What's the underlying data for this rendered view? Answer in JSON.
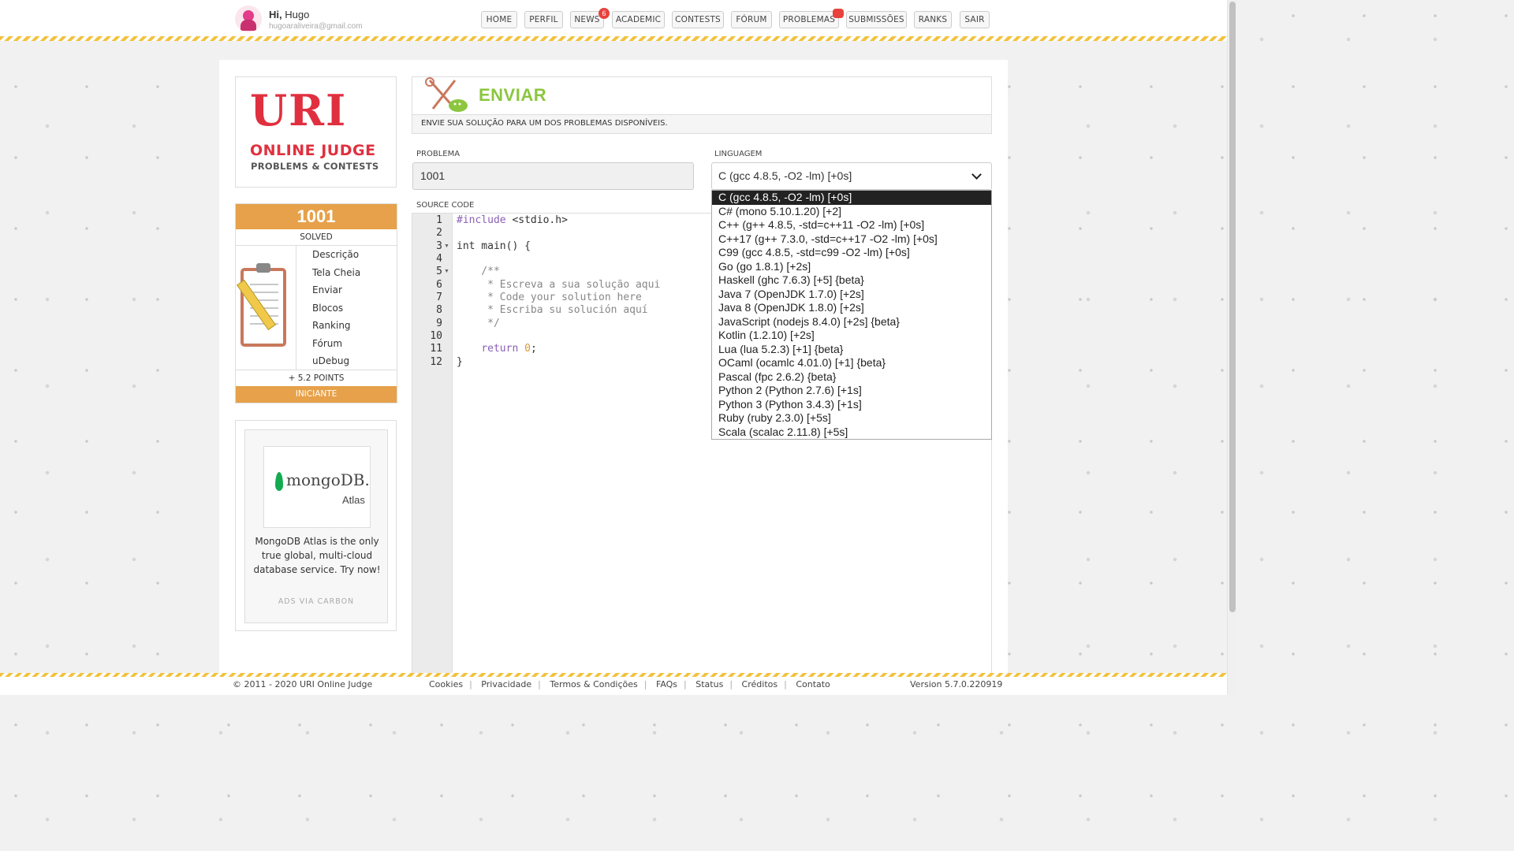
{
  "user": {
    "greeting": "Hi,",
    "name": "Hugo",
    "email": "hugoaraliveira@gmail.com"
  },
  "nav": {
    "home": "HOME",
    "perfil": "PERFIL",
    "news": "NEWS",
    "news_badge": "6",
    "academic": "ACADEMIC",
    "contests": "CONTESTS",
    "forum": "FÓRUM",
    "problemas": "PROBLEMAS",
    "submissoes": "SUBMISSÕES",
    "ranks": "RANKS",
    "sair": "SAIR"
  },
  "logo": {
    "uri": "URI",
    "online_judge": "ONLINE JUDGE",
    "tagline": "PROBLEMS & CONTESTS"
  },
  "problem_card": {
    "number": "1001",
    "status": "SOLVED",
    "menu": [
      "Descrição",
      "Tela Cheia",
      "Enviar",
      "Blocos",
      "Ranking",
      "Fórum",
      "uDebug"
    ],
    "points": "+ 5.2 POINTS",
    "level": "INICIANTE"
  },
  "ad": {
    "brand": "mongoDB.",
    "product": "Atlas",
    "text": "MongoDB Atlas is the only true global, multi-cloud database service. Try now!",
    "via": "ADS VIA CARBON"
  },
  "submit": {
    "title": "ENVIAR",
    "subtitle": "ENVIE SUA SOLUÇÃO PARA UM DOS PROBLEMAS DISPONÍVEIS.",
    "problem_label": "PROBLEMA",
    "problem_value": "1001",
    "language_label": "LINGUAGEM",
    "language_value": "C (gcc 4.8.5, -O2 -lm) [+0s]",
    "source_label": "SOURCE CODE"
  },
  "code": {
    "line_numbers": [
      "1",
      "2",
      "3",
      "4",
      "5",
      "6",
      "7",
      "8",
      "9",
      "10",
      "11",
      "12"
    ],
    "l1_pp": "#include",
    "l1_rest": " <stdio.h>",
    "l3": "int main() {",
    "l5": "    /**",
    "l6": "     * Escreva a sua solução aqui",
    "l7": "     * Code your solution here",
    "l8": "     * Escriba su solución aquí",
    "l9": "     */",
    "l11_kw": "return",
    "l11_num": "0",
    "l11_end": ";",
    "l12": "}"
  },
  "languages": [
    "C (gcc 4.8.5, -O2 -lm) [+0s]",
    "C# (mono 5.10.1.20) [+2]",
    "C++ (g++ 4.8.5, -std=c++11 -O2 -lm) [+0s]",
    "C++17 (g++ 7.3.0, -std=c++17 -O2 -lm) [+0s]",
    "C99 (gcc 4.8.5, -std=c99 -O2 -lm) [+0s]",
    "Go (go 1.8.1) [+2s]",
    "Haskell (ghc 7.6.3) [+5] {beta}",
    "Java 7 (OpenJDK 1.7.0) [+2s]",
    "Java 8 (OpenJDK 1.8.0) [+2s]",
    "JavaScript (nodejs 8.4.0) [+2s] {beta}",
    "Kotlin (1.2.10) [+2s]",
    "Lua (lua 5.2.3) [+1] {beta}",
    "OCaml (ocamlc 4.01.0) [+1] {beta}",
    "Pascal (fpc 2.6.2) {beta}",
    "Python 2 (Python 2.7.6) [+1s]",
    "Python 3 (Python 3.4.3) [+1s]",
    "Ruby (ruby 2.3.0) [+5s]",
    "Scala (scalac 2.11.8) [+5s]"
  ],
  "footer": {
    "copyright": "© 2011 - 2020 URI Online Judge",
    "links": [
      "Cookies",
      "Privacidade",
      "Termos & Condições",
      "FAQs",
      "Status",
      "Créditos",
      "Contato"
    ],
    "version": "Version 5.7.0.220919"
  },
  "colors": {
    "accent_orange": "#e6a14a",
    "accent_green": "#8cc63f",
    "brand_red": "#e0303f",
    "badge_red": "#e8423d"
  },
  "icons": [
    "user-avatar-icon",
    "clipboard-pencil-icon",
    "tools-icon",
    "mongodb-leaf-icon",
    "chevron-down-icon"
  ]
}
